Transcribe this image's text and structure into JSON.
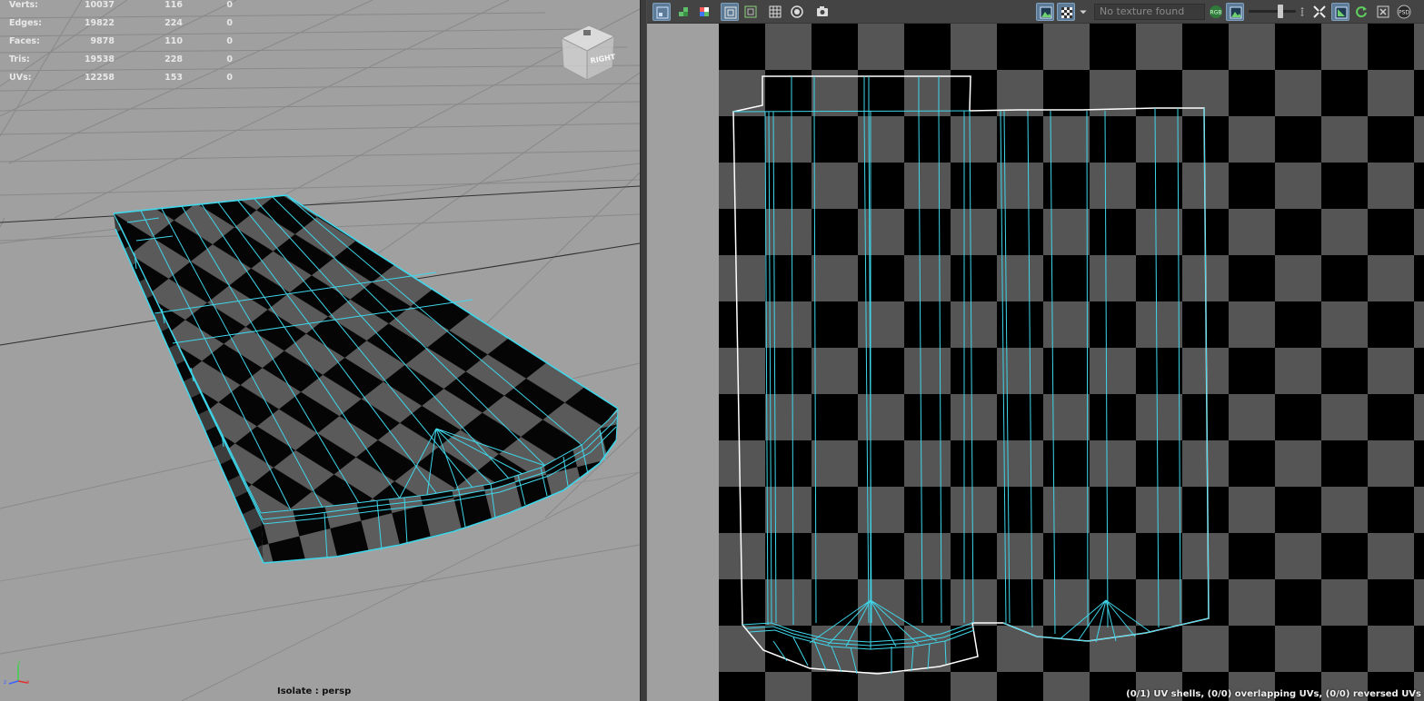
{
  "hud": {
    "rows": [
      {
        "label": "Verts:",
        "total": "10037",
        "selected": "116",
        "components": "0"
      },
      {
        "label": "Edges:",
        "total": "19822",
        "selected": "224",
        "components": "0"
      },
      {
        "label": "Faces:",
        "total": "9878",
        "selected": "110",
        "components": "0"
      },
      {
        "label": "Tris:",
        "total": "19538",
        "selected": "228",
        "components": "0"
      },
      {
        "label": "UVs:",
        "total": "12258",
        "selected": "153",
        "components": "0"
      }
    ]
  },
  "viewport": {
    "isolate_label": "Isolate : persp",
    "view_cube_label": "RIGHT",
    "background_color": "#a0a0a0",
    "wire_color": "#3fd6ea"
  },
  "uv_editor": {
    "texture_placeholder": "No texture found",
    "rgb_label": "RGB",
    "psd_label": "PSD",
    "status": "(0/1) UV shells, (0/0) overlapping UVs, (0/0) reversed UVs",
    "toolbar_icons": [
      "uv-toolkit-icon",
      "shaded-shells-icon",
      "distortion-icon",
      "uv-wireframe-icon",
      "uv-border-icon",
      "grid-icon",
      "snapshot-sphere-icon",
      "screenshot-icon",
      "image-display-icon",
      "checker-icon",
      "texture-dropdown-icon",
      "rgb-channel-icon",
      "alpha-icon",
      "exposure-slider-icon",
      "isolate-icon",
      "display-filter-icon",
      "refresh-icon",
      "close-icon",
      "psd-icon"
    ]
  }
}
